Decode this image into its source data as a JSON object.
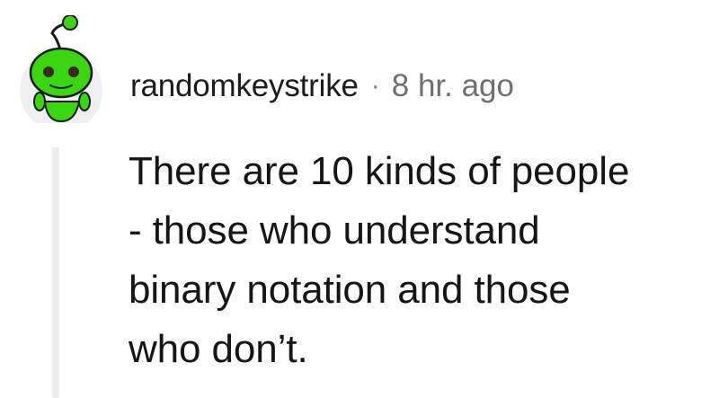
{
  "comment": {
    "author": "randomkeystrike",
    "separator": "·",
    "timestamp": "8 hr. ago",
    "body_lines": [
      "There are 10 kinds of people",
      "- those who understand",
      "binary notation and those",
      "who don’t."
    ],
    "avatar_icon": "snoo-avatar-icon",
    "avatar_color": "#39d611"
  }
}
